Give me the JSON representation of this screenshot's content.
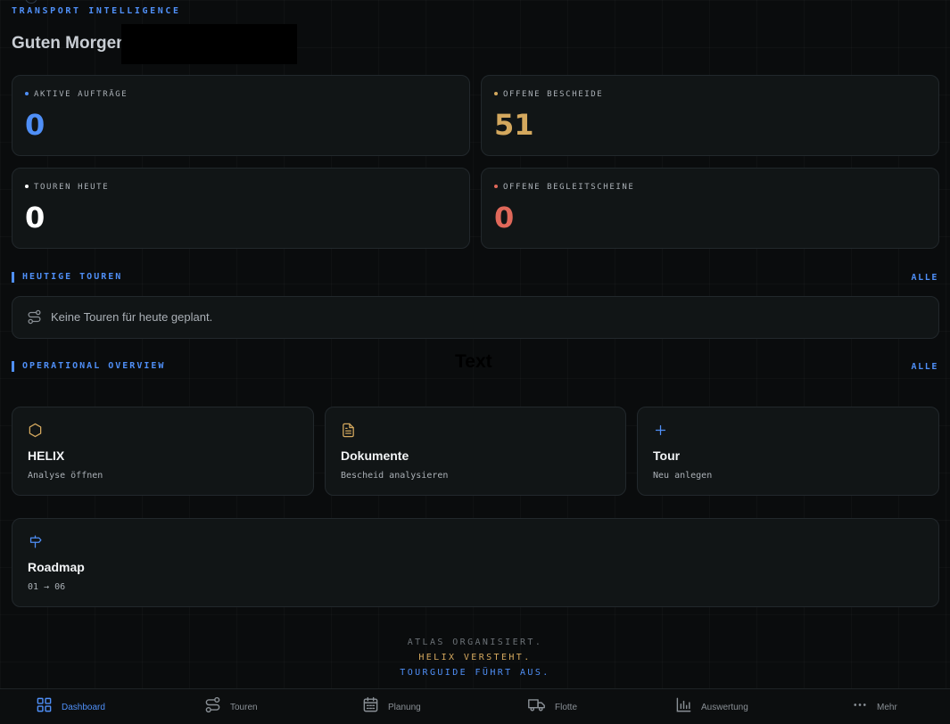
{
  "header": {
    "eyebrow": "TRANSPORT INTELLIGENCE",
    "greeting": "Guten Morgen,"
  },
  "stats": [
    {
      "label": "AKTIVE AUFTRÄGE",
      "value": "0",
      "color": "#4f8ff7"
    },
    {
      "label": "OFFENE BESCHEIDE",
      "value": "51",
      "color": "#d4a85e"
    },
    {
      "label": "TOUREN HEUTE",
      "value": "0",
      "color": "#ffffff"
    },
    {
      "label": "OFFENE BEGLEITSCHEINE",
      "value": "0",
      "color": "#e0685a"
    }
  ],
  "tours_section": {
    "title": "HEUTIGE TOUREN",
    "link": "ALLE",
    "empty_text": "Keine Touren für heute geplant."
  },
  "overview_section": {
    "title": "OPERATIONAL OVERVIEW",
    "link": "ALLE",
    "overlay_text": "Text"
  },
  "cards": [
    {
      "title": "HELIX",
      "subtitle": "Analyse öffnen",
      "icon": "hexagon-icon"
    },
    {
      "title": "Dokumente",
      "subtitle": "Bescheid analysieren",
      "icon": "document-icon"
    },
    {
      "title": "Tour",
      "subtitle": "Neu anlegen",
      "icon": "plus-icon"
    },
    {
      "title": "Roadmap",
      "subtitle": "01 → 06",
      "icon": "signpost-icon"
    }
  ],
  "motto": {
    "line1": "ATLAS ORGANISIERT.",
    "line2": "HELIX VERSTEHT.",
    "line3": "TOURGUIDE FÜHRT AUS."
  },
  "nav": {
    "items": [
      {
        "label": "Dashboard",
        "icon": "grid-icon",
        "active": true
      },
      {
        "label": "Touren",
        "icon": "route-icon",
        "active": false
      },
      {
        "label": "Planung",
        "icon": "calendar-icon",
        "active": false
      },
      {
        "label": "Flotte",
        "icon": "truck-icon",
        "active": false
      },
      {
        "label": "Auswertung",
        "icon": "bar-chart-icon",
        "active": false
      },
      {
        "label": "Mehr",
        "icon": "more-icon",
        "active": false
      }
    ]
  },
  "colors": {
    "accent": "#4f8ff7",
    "gold": "#d4a85e",
    "red": "#e0685a"
  }
}
